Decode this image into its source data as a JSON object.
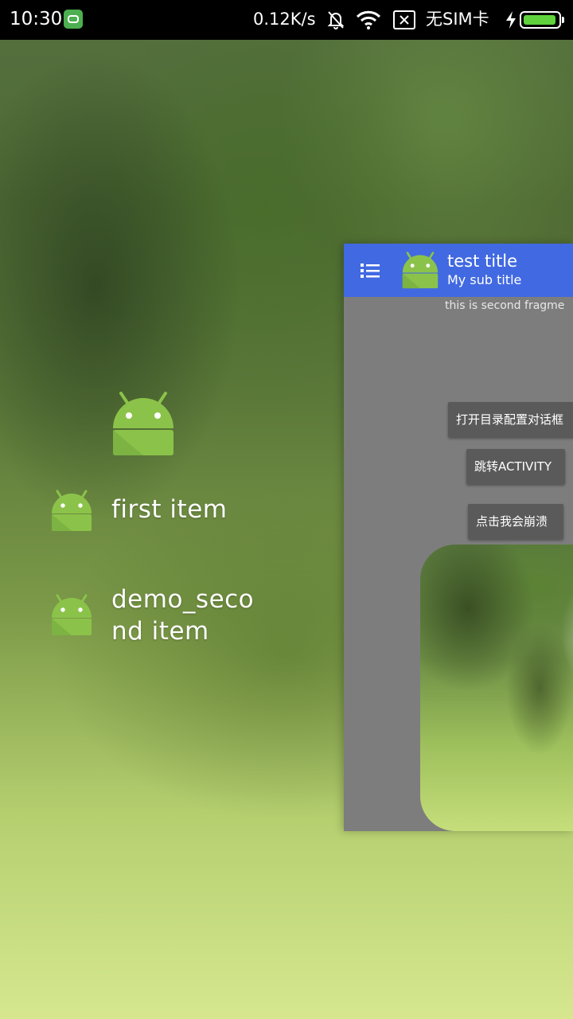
{
  "status_bar": {
    "time": "10:30",
    "network_speed": "0.12K/s",
    "carrier": "无SIM卡",
    "battery_level": 0.95,
    "icons": [
      "app-notification-icon",
      "bell-off-icon",
      "wifi-icon",
      "no-sim-icon",
      "charging-icon",
      "battery-icon"
    ]
  },
  "drawer": {
    "header_icon": "android-robot-icon",
    "items": [
      {
        "label": "first item",
        "icon": "android-robot-icon"
      },
      {
        "label": "demo_second item",
        "icon": "android-robot-icon"
      }
    ]
  },
  "main": {
    "toolbar": {
      "title": "test title",
      "subtitle": "My sub title",
      "nav_icon": "list-menu-icon",
      "logo_icon": "android-robot-icon"
    },
    "fragment_text": "this is second fragme",
    "buttons": {
      "open_dialog": "打开目录配置对话框",
      "jump_activity": "跳转ACTIVITY",
      "crash": "点击我会崩溃"
    }
  },
  "colors": {
    "toolbar": "#4169e1",
    "panel_background": "#7d7d7d",
    "button_background": "#5a5a5a",
    "android_green": "#8bc34a",
    "battery_fill": "#5fd23c"
  }
}
